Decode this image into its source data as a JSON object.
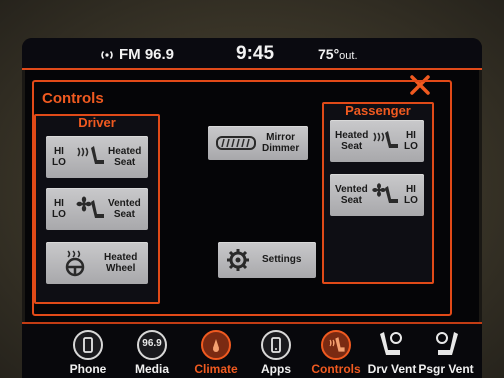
{
  "status": {
    "radio": "FM 96.9",
    "clock": "9:45",
    "temperature": "75°",
    "temperature_suffix": "out."
  },
  "panel": {
    "title": "Controls",
    "driver": {
      "title": "Driver",
      "heated_seat": {
        "hi": "HI",
        "lo": "LO",
        "label_line1": "Heated",
        "label_line2": "Seat"
      },
      "vented_seat": {
        "hi": "HI",
        "lo": "LO",
        "label_line1": "Vented",
        "label_line2": "Seat"
      },
      "heated_wheel": {
        "label_line1": "Heated",
        "label_line2": "Wheel"
      }
    },
    "center": {
      "mirror_dimmer": {
        "label_line1": "Mirror",
        "label_line2": "Dimmer"
      },
      "settings": {
        "label": "Settings"
      }
    },
    "passenger": {
      "title": "Passenger",
      "heated_seat": {
        "hi": "HI",
        "lo": "LO",
        "label_line1": "Heated",
        "label_line2": "Seat"
      },
      "vented_seat": {
        "hi": "HI",
        "lo": "LO",
        "label_line1": "Vented",
        "label_line2": "Seat"
      }
    }
  },
  "nav": {
    "items": [
      {
        "label": "Phone",
        "icon": "phone-icon",
        "active": false
      },
      {
        "label": "Media",
        "icon": "media-icon",
        "badge": "96.9",
        "active": false
      },
      {
        "label": "Climate",
        "icon": "climate-icon",
        "active": true
      },
      {
        "label": "Apps",
        "icon": "apps-icon",
        "active": false
      },
      {
        "label": "Controls",
        "icon": "controls-icon",
        "active": true
      },
      {
        "label": "Drv Vent",
        "icon": "driver-vent-icon",
        "active": false
      },
      {
        "label": "Psgr Vent",
        "icon": "passenger-vent-icon",
        "active": false
      }
    ]
  },
  "colors": {
    "accent": "#f05a20",
    "button": "#bdbdbf",
    "background": "#050507"
  }
}
